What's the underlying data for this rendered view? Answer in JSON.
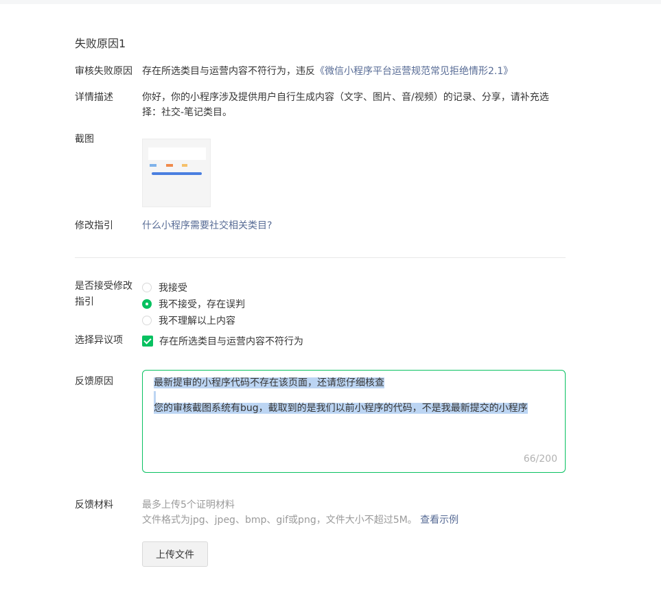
{
  "section_title": "失败原因1",
  "reason": {
    "label": "审核失败原因",
    "text": "存在所选类目与运营内容不符行为，违反",
    "link": "《微信小程序平台运营规范常见拒绝情形2.1》"
  },
  "detail": {
    "label": "详情描述",
    "line1": "你好，你的小程序涉及提供用户自行生成内容（文字、图片、音/视频）的记录、分享，请补充选",
    "line2": "择：社交-笔记类目。"
  },
  "screenshot": {
    "label": "截图"
  },
  "guide": {
    "label": "修改指引",
    "link": "什么小程序需要社交相关类目?"
  },
  "accept": {
    "label_line1": "是否接受修改",
    "label_line2": "指引",
    "options": [
      {
        "label": "我接受",
        "checked": false
      },
      {
        "label": "我不接受，存在误判",
        "checked": true
      },
      {
        "label": "我不理解以上内容",
        "checked": false
      }
    ]
  },
  "objection": {
    "label": "选择异议项",
    "option": "存在所选类目与运营内容不符行为",
    "checked": true
  },
  "feedback": {
    "label": "反馈原因",
    "line1": "最新提审的小程序代码不存在该页面，还请您仔细核查",
    "line2": "",
    "line3": "您的审核截图系统有bug，截取到的是我们以前小程序的代码，不是我最新提交的小程序",
    "counter": "66/200"
  },
  "materials": {
    "label": "反馈材料",
    "hint1": "最多上传5个证明材料",
    "hint2": "文件格式为jpg、jpeg、bmp、gif或png，文件大小不超过5M。",
    "example_link": "查看示例",
    "upload_button": "上传文件"
  },
  "colors": {
    "accent": "#07c160",
    "link": "#576b95",
    "selection": "#bcd5f3"
  }
}
